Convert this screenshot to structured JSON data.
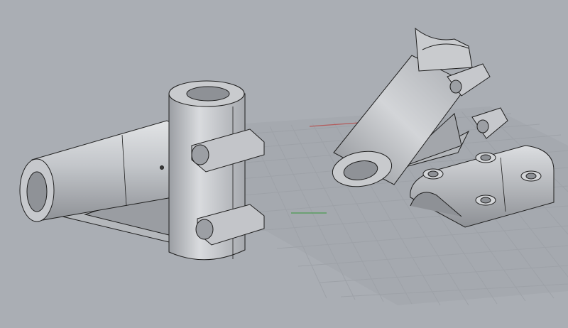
{
  "viewport": {
    "background": "#aaaeb4",
    "grid_color": "#9da1a7",
    "x_axis_color": "#b45a5a",
    "y_axis_color": "#4c9a52"
  },
  "models": {
    "part_a": "assembled-bracket",
    "part_b": "exploded-bracket",
    "part_c": "clamp-cap"
  },
  "shading": {
    "body_light": "#d4d6d9",
    "body_mid": "#b6b9bd",
    "body_dark": "#8e9196",
    "edge_color": "#1e1e1e"
  }
}
